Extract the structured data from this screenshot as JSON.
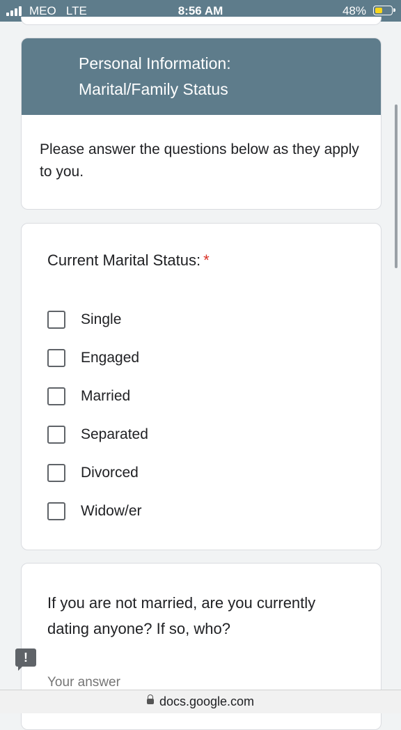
{
  "status_bar": {
    "carrier": "MEO",
    "network": "LTE",
    "time": "8:56 AM",
    "battery_percent": "48%",
    "battery_level": 0.48,
    "battery_color": "#f9d71c"
  },
  "section": {
    "title_line1": "Personal Information:",
    "title_line2": "Marital/Family Status",
    "description": "Please answer the questions below as they apply to you.",
    "header_color": "#5e7c8b"
  },
  "question1": {
    "title": "Current Marital Status:",
    "required_mark": "*",
    "options": [
      {
        "label": "Single",
        "checked": false
      },
      {
        "label": "Engaged",
        "checked": false
      },
      {
        "label": "Married",
        "checked": false
      },
      {
        "label": "Separated",
        "checked": false
      },
      {
        "label": "Divorced",
        "checked": false
      },
      {
        "label": "Widow/er",
        "checked": false
      }
    ]
  },
  "question2": {
    "title": "If you are not married, are you currently dating anyone? If so, who?",
    "placeholder": "Your answer",
    "value": ""
  },
  "feedback": {
    "icon": "report-feedback-icon",
    "glyph": "!"
  },
  "browser": {
    "url": "docs.google.com",
    "lock_icon": "lock-icon"
  }
}
